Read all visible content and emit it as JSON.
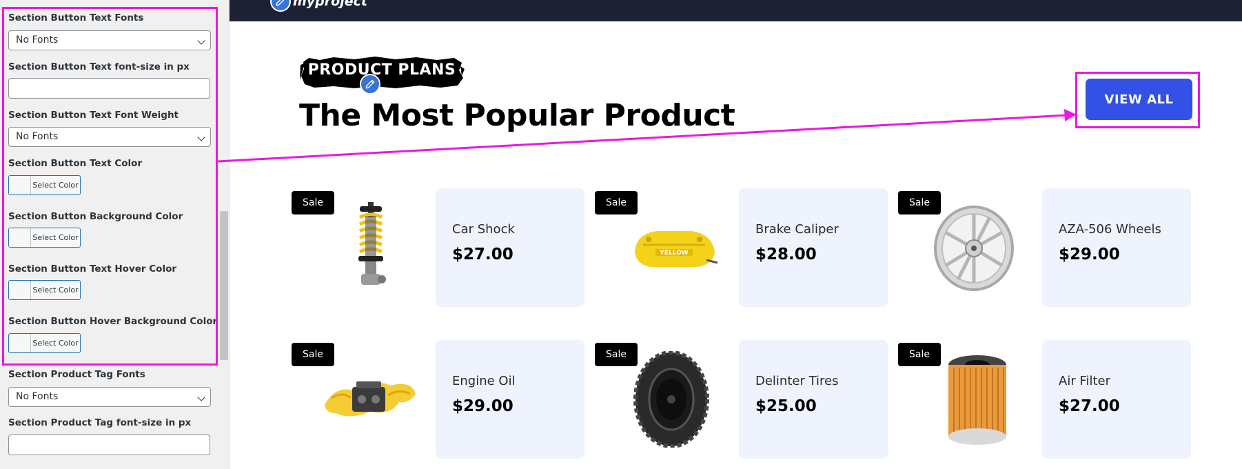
{
  "customizer": {
    "fields": [
      {
        "label": "Section Button Text Fonts",
        "type": "select",
        "value": "No Fonts"
      },
      {
        "label": "Section Button Text font-size in px",
        "type": "text",
        "value": ""
      },
      {
        "label": "Section Button Text Font Weight",
        "type": "select",
        "value": "No Fonts"
      },
      {
        "label": "Section Button Text Color",
        "type": "color",
        "button_label": "Select Color"
      },
      {
        "label": "Section Button Background Color",
        "type": "color",
        "button_label": "Select Color"
      },
      {
        "label": "Section Button Text Hover Color",
        "type": "color",
        "button_label": "Select Color"
      },
      {
        "label": "Section Button Hover Background Color",
        "type": "color",
        "button_label": "Select Color"
      },
      {
        "label": "Section Product Tag Fonts",
        "type": "select",
        "value": "No Fonts"
      },
      {
        "label": "Section Product Tag font-size in px",
        "type": "text",
        "value": ""
      }
    ]
  },
  "site": {
    "logo_text": "myproject",
    "section_tag": "PRODUCT PLANS",
    "section_title": "The Most Popular Product",
    "view_all_label": "VIEW ALL"
  },
  "products": [
    {
      "name": "Car Shock",
      "price": "$27.00",
      "badge": "Sale",
      "icon": "car-shock-image"
    },
    {
      "name": "Brake Caliper",
      "price": "$28.00",
      "badge": "Sale",
      "icon": "brake-caliper-image"
    },
    {
      "name": "AZA-506 Wheels",
      "price": "$29.00",
      "badge": "Sale",
      "icon": "wheel-image"
    },
    {
      "name": "Engine Oil",
      "price": "$29.00",
      "badge": "Sale",
      "icon": "engine-oil-image"
    },
    {
      "name": "Delinter Tires",
      "price": "$25.00",
      "badge": "Sale",
      "icon": "tire-image"
    },
    {
      "name": "Air Filter",
      "price": "$27.00",
      "badge": "Sale",
      "icon": "air-filter-image"
    }
  ],
  "colors": {
    "highlight": "#ec17e3",
    "button": "#3351e6",
    "topbar": "#1c2233",
    "card_bg": "#eef3fd"
  }
}
